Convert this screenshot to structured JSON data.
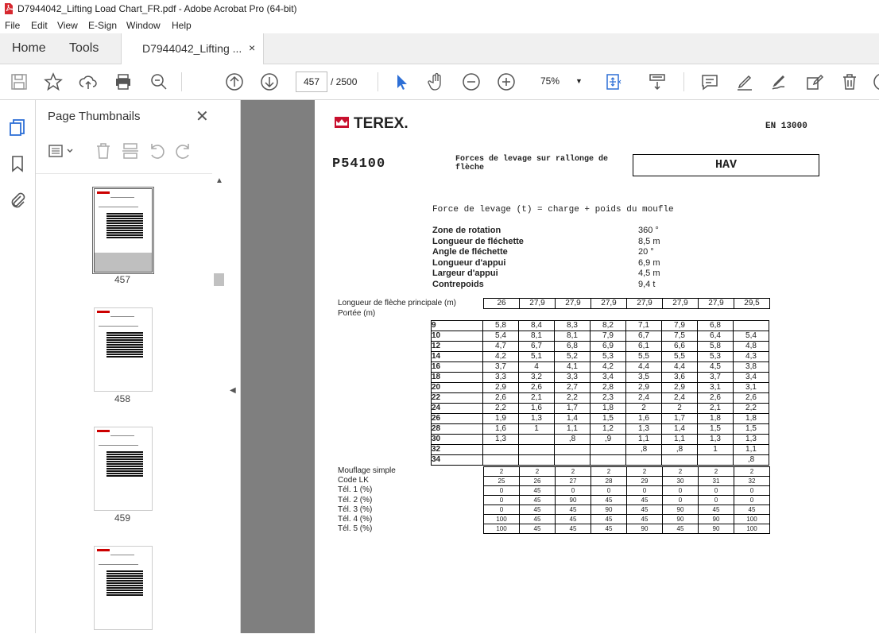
{
  "window": {
    "title": "D7944042_Lifting Load Chart_FR.pdf - Adobe Acrobat Pro (64-bit)"
  },
  "menu": [
    "File",
    "Edit",
    "View",
    "E-Sign",
    "Window",
    "Help"
  ],
  "tabs": {
    "home": "Home",
    "tools": "Tools",
    "doc": "D7944042_Lifting ...",
    "close": "×"
  },
  "toolbar": {
    "page_current": "457",
    "page_total": "/ 2500",
    "zoom": "75%",
    "icons": [
      "save-icon",
      "bookmark-star-icon",
      "upload-cloud-icon",
      "print-icon",
      "zoom-search-icon",
      "page-up-icon",
      "page-down-icon",
      "select-cursor-icon",
      "hand-icon",
      "zoom-out-icon",
      "zoom-in-icon",
      "fit-page-icon",
      "scroll-mode-icon",
      "comment-icon",
      "highlight-icon",
      "sign-icon",
      "edit-icon",
      "delete-icon"
    ]
  },
  "sidebar": {
    "title": "Page Thumbnails",
    "close": "✕",
    "thumbnails": [
      {
        "label": "457",
        "selected": true
      },
      {
        "label": "458",
        "selected": false
      },
      {
        "label": "459",
        "selected": false
      },
      {
        "label": "",
        "selected": false
      }
    ]
  },
  "document": {
    "brand": "TEREX.",
    "standard": "EN 13000",
    "model": "P54100",
    "heading_line1": "Forces de levage sur rallonge de",
    "heading_line2": "flèche",
    "mode": "HAV",
    "formula": "Force de levage (t) = charge + poids du moufle",
    "params": [
      {
        "label": "Zone de rotation",
        "value": "360 °"
      },
      {
        "label": "Longueur de fléchette",
        "value": "8,5 m"
      },
      {
        "label": "Angle de fléchette",
        "value": "20 °"
      },
      {
        "label": "Longueur d'appui",
        "value": "6,9 m"
      },
      {
        "label": "Largeur d'appui",
        "value": "4,5 m"
      },
      {
        "label": "Contrepoids",
        "value": "9,4 t"
      }
    ],
    "boom_label": "Longueur de flèche principale (m)",
    "radius_label": "Portée (m)",
    "boom_lengths": [
      "26",
      "27,9",
      "27,9",
      "27,9",
      "27,9",
      "27,9",
      "27,9",
      "29,5"
    ],
    "rows": [
      {
        "r": "9",
        "v": [
          "5,8",
          "8,4",
          "8,3",
          "8,2",
          "7,1",
          "7,9",
          "6,8",
          ""
        ]
      },
      {
        "r": "10",
        "v": [
          "5,4",
          "8,1",
          "8,1",
          "7,9",
          "6,7",
          "7,5",
          "6,4",
          "5,4"
        ]
      },
      {
        "r": "12",
        "v": [
          "4,7",
          "6,7",
          "6,8",
          "6,9",
          "6,1",
          "6,6",
          "5,8",
          "4,8"
        ]
      },
      {
        "r": "14",
        "v": [
          "4,2",
          "5,1",
          "5,2",
          "5,3",
          "5,5",
          "5,5",
          "5,3",
          "4,3"
        ]
      },
      {
        "r": "16",
        "v": [
          "3,7",
          "4",
          "4,1",
          "4,2",
          "4,4",
          "4,4",
          "4,5",
          "3,8"
        ]
      },
      {
        "r": "18",
        "v": [
          "3,3",
          "3,2",
          "3,3",
          "3,4",
          "3,5",
          "3,6",
          "3,7",
          "3,4"
        ]
      },
      {
        "r": "20",
        "v": [
          "2,9",
          "2,6",
          "2,7",
          "2,8",
          "2,9",
          "2,9",
          "3,1",
          "3,1"
        ]
      },
      {
        "r": "22",
        "v": [
          "2,6",
          "2,1",
          "2,2",
          "2,3",
          "2,4",
          "2,4",
          "2,6",
          "2,6"
        ]
      },
      {
        "r": "24",
        "v": [
          "2,2",
          "1,6",
          "1,7",
          "1,8",
          "2",
          "2",
          "2,1",
          "2,2"
        ]
      },
      {
        "r": "26",
        "v": [
          "1,9",
          "1,3",
          "1,4",
          "1,5",
          "1,6",
          "1,7",
          "1,8",
          "1,8"
        ]
      },
      {
        "r": "28",
        "v": [
          "1,6",
          "1",
          "1,1",
          "1,2",
          "1,3",
          "1,4",
          "1,5",
          "1,5"
        ]
      },
      {
        "r": "30",
        "v": [
          "1,3",
          "",
          ",8",
          ",9",
          "1,1",
          "1,1",
          "1,3",
          "1,3"
        ]
      },
      {
        "r": "32",
        "v": [
          "",
          "",
          "",
          "",
          ",8",
          ",8",
          "1",
          "1,1"
        ]
      },
      {
        "r": "34",
        "v": [
          "",
          "",
          "",
          "",
          "",
          "",
          "",
          ",8"
        ]
      }
    ],
    "bottom_rows": [
      {
        "label": "Mouflage simple",
        "v": [
          "2",
          "2",
          "2",
          "2",
          "2",
          "2",
          "2",
          "2"
        ]
      },
      {
        "label": "Code LK",
        "v": [
          "25",
          "26",
          "27",
          "28",
          "29",
          "30",
          "31",
          "32"
        ]
      },
      {
        "label": "Tél. 1 (%)",
        "v": [
          "0",
          "45",
          "0",
          "0",
          "0",
          "0",
          "0",
          "0"
        ]
      },
      {
        "label": "Tél. 2 (%)",
        "v": [
          "0",
          "45",
          "90",
          "45",
          "45",
          "0",
          "0",
          "0"
        ]
      },
      {
        "label": "Tél. 3 (%)",
        "v": [
          "0",
          "45",
          "45",
          "90",
          "45",
          "90",
          "45",
          "45"
        ]
      },
      {
        "label": "Tél. 4 (%)",
        "v": [
          "100",
          "45",
          "45",
          "45",
          "45",
          "90",
          "90",
          "100"
        ]
      },
      {
        "label": "Tél. 5 (%)",
        "v": [
          "100",
          "45",
          "45",
          "45",
          "90",
          "45",
          "90",
          "100"
        ]
      }
    ]
  }
}
